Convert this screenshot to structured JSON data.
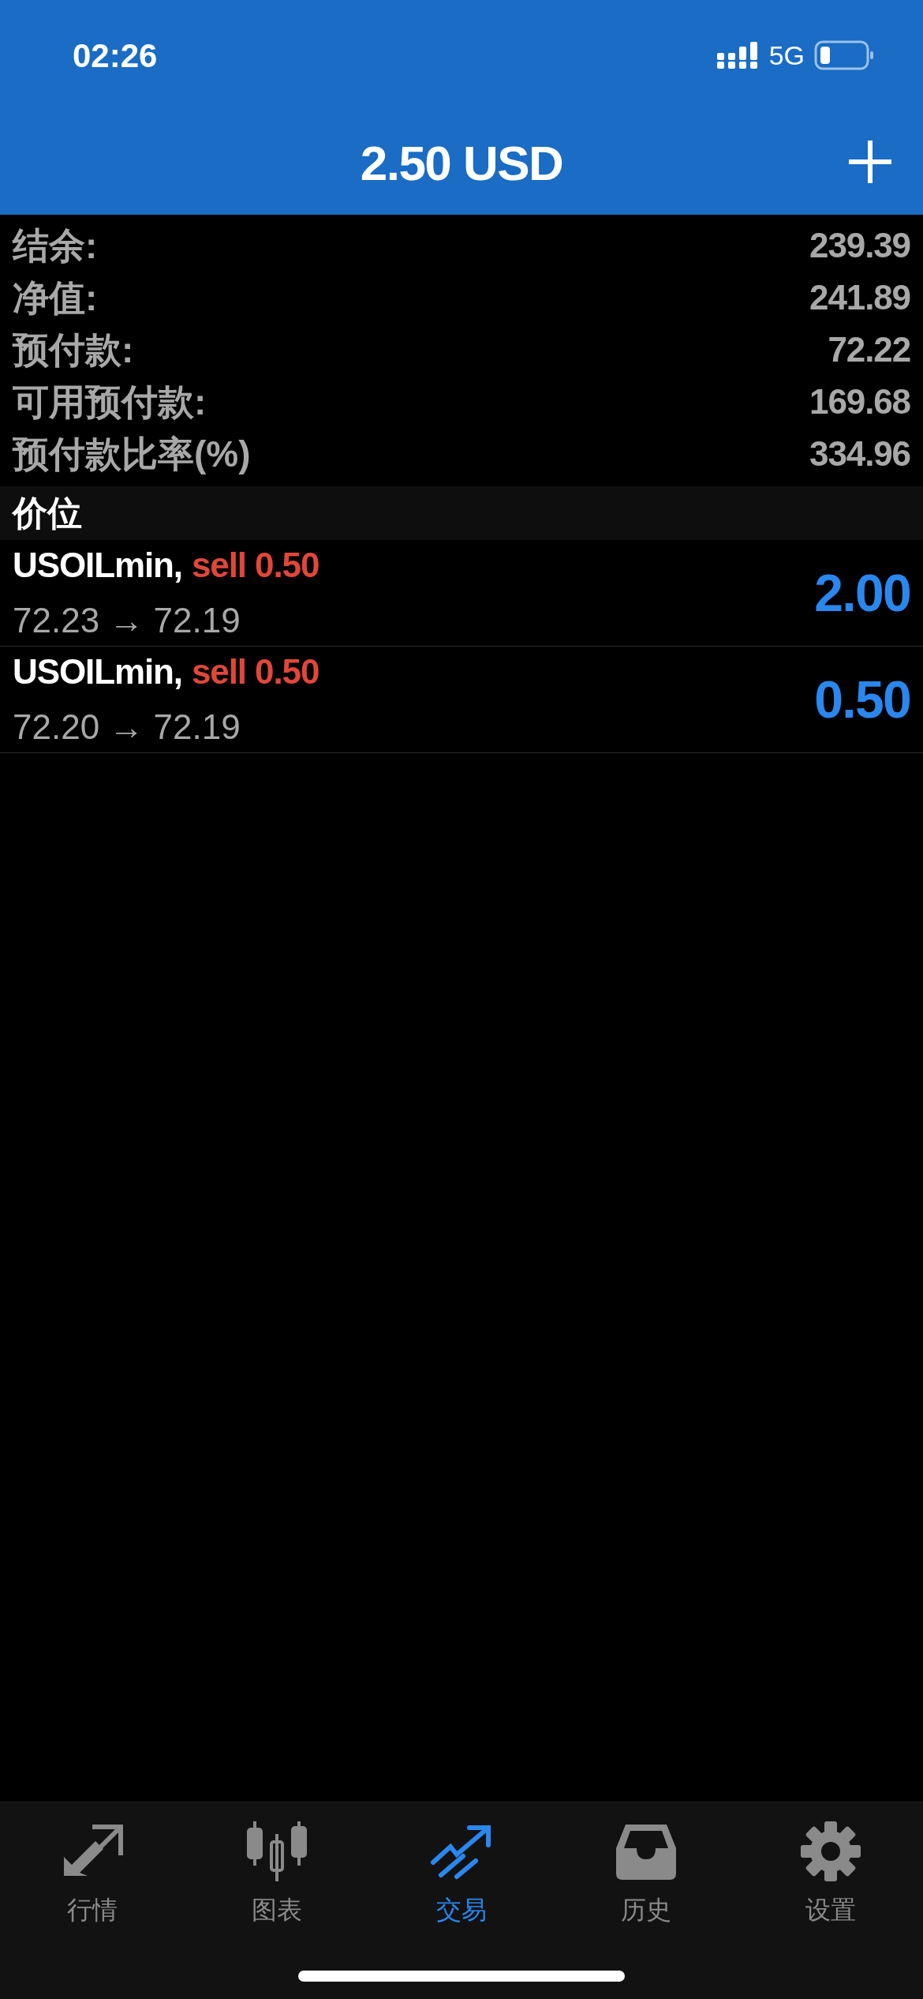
{
  "status_bar": {
    "time": "02:26",
    "network": "5G"
  },
  "header": {
    "title": "2.50 USD"
  },
  "summary": [
    {
      "label": "结余:",
      "value": "239.39"
    },
    {
      "label": "净值:",
      "value": "241.89"
    },
    {
      "label": "预付款:",
      "value": "72.22"
    },
    {
      "label": "可用预付款:",
      "value": "169.68"
    },
    {
      "label": "预付款比率(%)",
      "value": "334.96"
    }
  ],
  "section": {
    "title": "价位"
  },
  "positions": [
    {
      "symbol": "USOILmin,",
      "order": "sell 0.50",
      "prices": "72.23 → 72.19",
      "profit": "2.00"
    },
    {
      "symbol": "USOILmin,",
      "order": "sell 0.50",
      "prices": "72.20 → 72.19",
      "profit": "0.50"
    }
  ],
  "tabs": [
    {
      "kind": "quotes",
      "label": "行情",
      "selected": false
    },
    {
      "kind": "charts",
      "label": "图表",
      "selected": false
    },
    {
      "kind": "trade",
      "label": "交易",
      "selected": true
    },
    {
      "kind": "history",
      "label": "历史",
      "selected": false
    },
    {
      "kind": "settings",
      "label": "设置",
      "selected": false
    }
  ]
}
